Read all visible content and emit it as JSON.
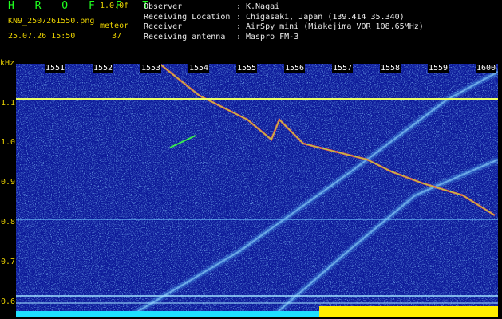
{
  "header": {
    "logo": "H R O F F T",
    "version": "1.0.0f",
    "filename": "KN9_2507261550.png",
    "mode": "meteor",
    "datetime": "25.07.26 15:50",
    "count": "37",
    "info": [
      {
        "key": "Observer",
        "value": "K.Nagai"
      },
      {
        "key": "Receiving Location",
        "value": "Chigasaki, Japan (139.414 35.340)"
      },
      {
        "key": "Receiver",
        "value": "AirSpy mini (Miakejima VOR 108.65MHz)"
      },
      {
        "key": "Receiving antenna",
        "value": "Maspro FM-3"
      }
    ]
  },
  "plot": {
    "y_unit": "kHz",
    "y_ticks": [
      "1.1",
      "1.0",
      "0.9",
      "0.8",
      "0.7",
      "0.6"
    ],
    "minutes": [
      "1551",
      "1552",
      "1553",
      "1554",
      "1555",
      "1556",
      "1557",
      "1558",
      "1559",
      "1600"
    ]
  },
  "colors": {
    "background": "#000000",
    "plot_bg": "#0d1a9a",
    "label": "#e8d000",
    "logo": "#1fff1f"
  }
}
